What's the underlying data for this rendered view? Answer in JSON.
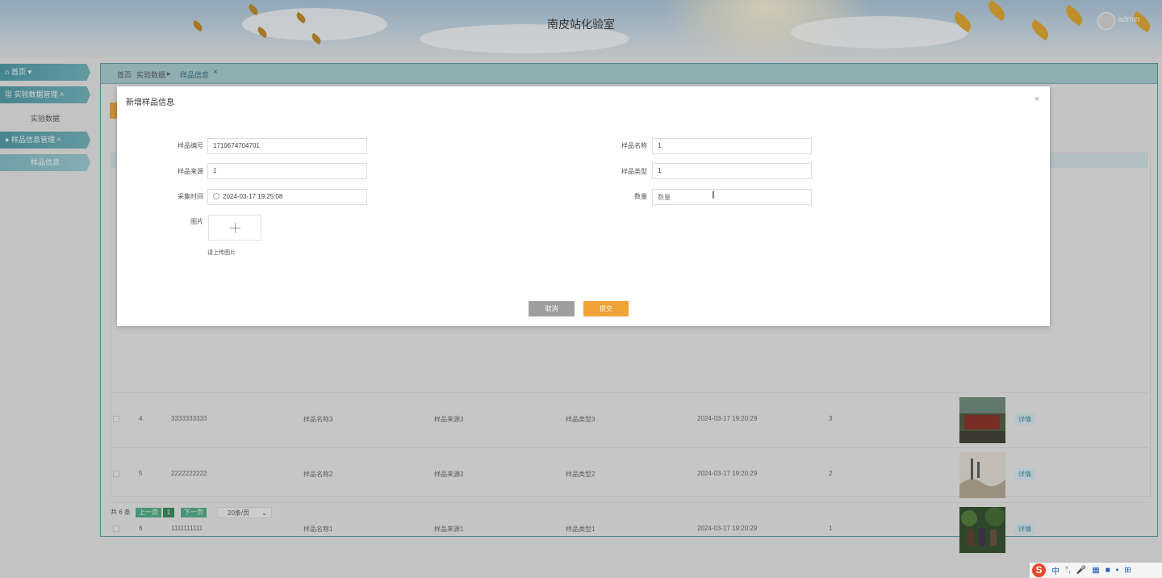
{
  "header": {
    "title": "南皮站化验室",
    "username": "admin"
  },
  "sidebar": {
    "home": "首页",
    "lab_data_mgmt": "实验数据管理",
    "lab_data": "实验数据",
    "sample_mgmt": "样品信息管理",
    "sample_info": "样品信息"
  },
  "tabs": {
    "home": "首页",
    "lab_data": "实验数据",
    "sample_info": "样品信息"
  },
  "table": {
    "rows": [
      {
        "idx": "4",
        "code": "3333333333",
        "name": "样品名称3",
        "source": "样品来源3",
        "type": "样品类型3",
        "time": "2024-03-17 19:20:29",
        "qty": "3"
      },
      {
        "idx": "5",
        "code": "2222222222",
        "name": "样品名称2",
        "source": "样品来源2",
        "type": "样品类型2",
        "time": "2024-03-17 19:20:29",
        "qty": "2"
      },
      {
        "idx": "6",
        "code": "1111111111",
        "name": "样品名称1",
        "source": "样品来源1",
        "type": "样品类型1",
        "time": "2024-03-17 19:20:29",
        "qty": "1"
      }
    ],
    "detail_label": "详情"
  },
  "pager": {
    "total": "共 6 条",
    "prev": "上一页",
    "page": "1",
    "next": "下一页",
    "size": "20条/页"
  },
  "modal": {
    "title": "新增样品信息",
    "close": "×",
    "fields": {
      "code_label": "样品编号",
      "code_value": "1710674704701",
      "name_label": "样品名称",
      "name_value": "1",
      "source_label": "样品来源",
      "source_value": "1",
      "type_label": "样品类型",
      "type_value": "1",
      "time_label": "采集时间",
      "time_value": "2024-03-17 19:25:08",
      "qty_label": "数量",
      "qty_placeholder": "数量",
      "image_label": "图片",
      "upload_tip": "请上传图片"
    },
    "cancel": "取消",
    "submit": "提交"
  },
  "ime": {
    "mode": "中",
    "punct": "°,"
  },
  "colors": {
    "accent": "#f0a237",
    "primary": "#4a9aa6",
    "pager": "#4caf86"
  }
}
